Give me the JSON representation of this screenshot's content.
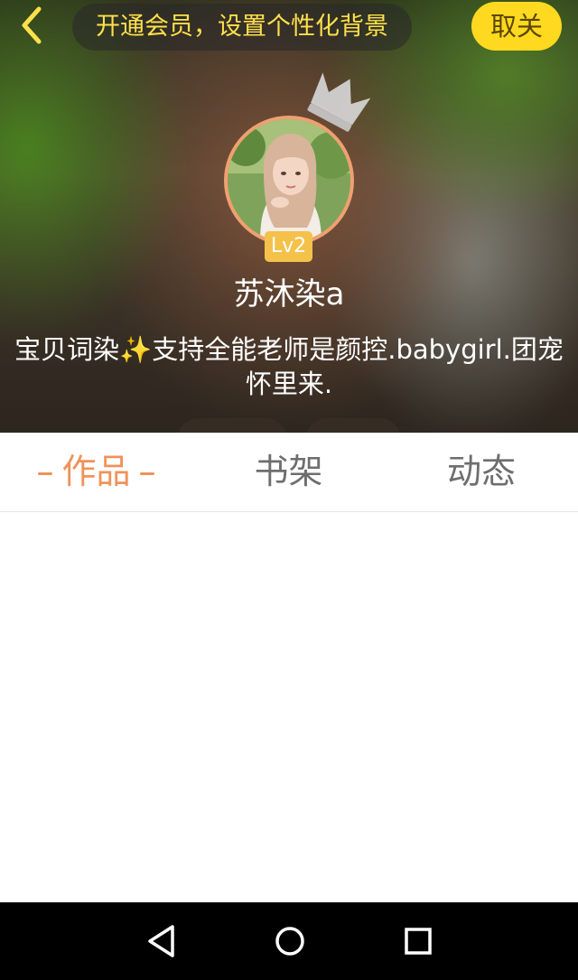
{
  "header": {
    "back_icon": "chevron-left-icon",
    "vip_banner_text": "开通会员，设置个性化背景",
    "follow_label": "取关",
    "colors": {
      "follow_button": "#ffd91f",
      "vip_text": "#ffe04a",
      "avatar_border": "#f0a070"
    }
  },
  "profile": {
    "avatar_icon": "user-avatar-photo",
    "crown_icon": "crown-icon",
    "level": "Lv2",
    "nickname": "苏沐染a",
    "bio": "宝贝词染✨支持全能老师是颜控.babygirl.团宠怀里来."
  },
  "tabs": [
    {
      "label": "作品",
      "active": true
    },
    {
      "label": "书架",
      "active": false
    },
    {
      "label": "动态",
      "active": false
    }
  ],
  "tab_active_color": "#f0925a",
  "navbar": {
    "back_icon": "triangle-back-icon",
    "home_icon": "circle-home-icon",
    "recents_icon": "square-recents-icon"
  }
}
